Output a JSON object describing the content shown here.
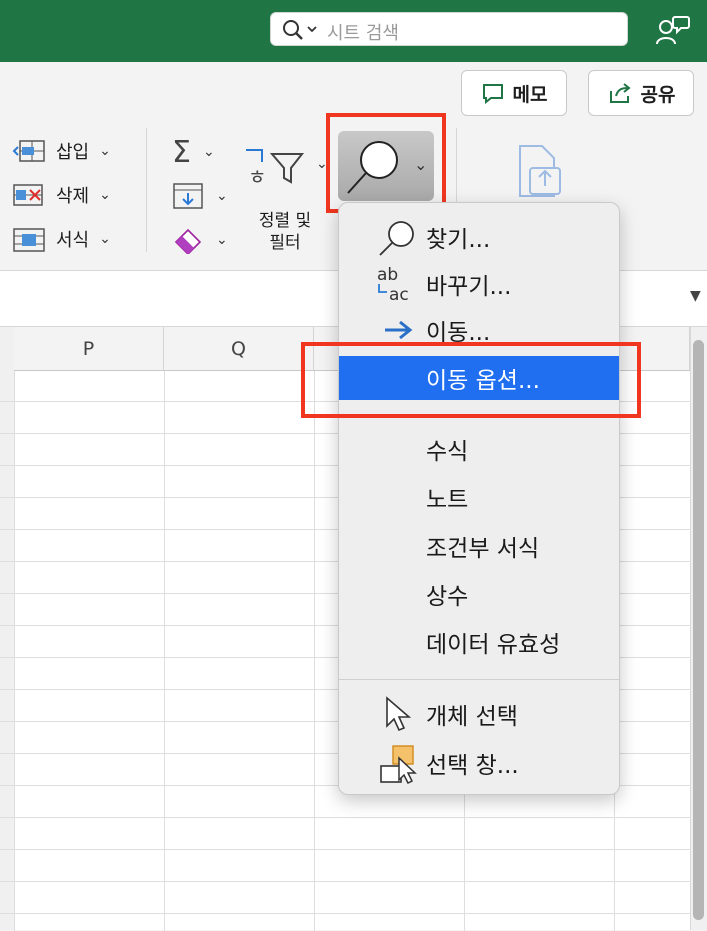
{
  "search": {
    "placeholder": "시트 검색"
  },
  "header": {
    "memo_label": "메모",
    "share_label": "공유"
  },
  "ribbon": {
    "cells": {
      "insert": "삽입",
      "delete": "삭제",
      "format": "서식"
    },
    "sort_filter": {
      "line1": "정렬 및",
      "line2": "필터"
    }
  },
  "columns": [
    "P",
    "Q"
  ],
  "menu": {
    "items": [
      {
        "label": "찾기...",
        "icon": "magnifier-icon"
      },
      {
        "label": "바꾸기...",
        "icon": "replace-icon"
      },
      {
        "label": "이동...",
        "icon": "arrow-right-icon"
      },
      {
        "label": "이동 옵션...",
        "selected": true
      },
      {
        "label": "수식"
      },
      {
        "label": "노트"
      },
      {
        "label": "조건부 서식"
      },
      {
        "label": "상수"
      },
      {
        "label": "데이터 유효성"
      },
      {
        "label": "개체 선택",
        "icon": "pointer-icon"
      },
      {
        "label": "선택 창...",
        "icon": "selection-pane-icon"
      }
    ]
  },
  "colors": {
    "titlebar": "#1f7544",
    "highlight": "#f0361f",
    "selection": "#1f6ff0"
  }
}
